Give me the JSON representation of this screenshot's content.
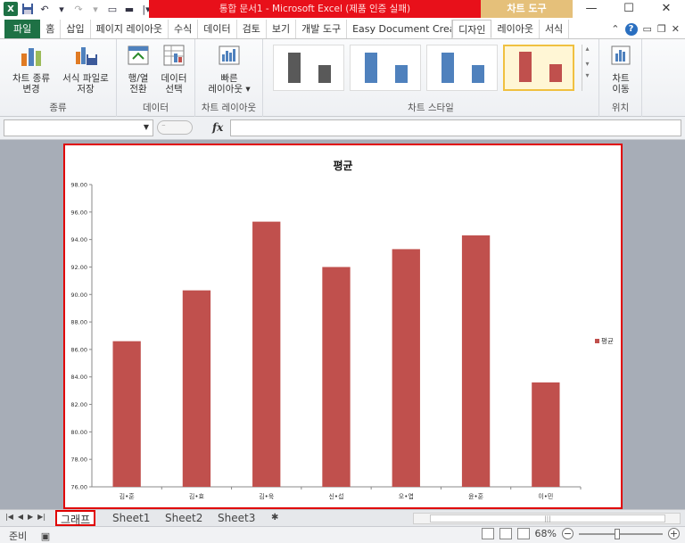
{
  "title_bar": {
    "window_title": "통합 문서1 - Microsoft Excel (제품 인증 실패)",
    "context_tab_group": "차트 도구",
    "minimize": "—",
    "maximize": "☐",
    "close": "✕"
  },
  "ribbon_tabs": {
    "file": "파일",
    "items": [
      "홈",
      "삽입",
      "페이지 레이아웃",
      "수식",
      "데이터",
      "검토",
      "보기",
      "개발 도구",
      "Easy Document Creato",
      "디자인",
      "레이아웃",
      "서식"
    ],
    "active": "디자인"
  },
  "ribbon": {
    "groups": {
      "type": {
        "label": "종류",
        "change_chart_type": "차트 종류\n변경",
        "save_template": "서식 파일로\n저장"
      },
      "data": {
        "label": "데이터",
        "switch_row_col": "행/열\n전환",
        "select_data": "데이터\n선택"
      },
      "layouts": {
        "label": "차트 레이아웃",
        "quick_layout": "빠른\n레이아웃 ▾"
      },
      "styles": {
        "label": "차트 스타일"
      },
      "location": {
        "label": "위치",
        "move_chart": "차트\n이동"
      }
    },
    "style_colors": [
      "#595959",
      "#4f81bd",
      "#4f81bd",
      "#c0504d"
    ]
  },
  "formula_bar": {
    "fx": "fx",
    "namebox_value": "",
    "formula_value": ""
  },
  "chart_data": {
    "type": "bar",
    "title": "평균",
    "categories": [
      "김•훈",
      "김•효",
      "김•욱",
      "신•섭",
      "오•엽",
      "윤•훈",
      "이•민"
    ],
    "series": [
      {
        "name": "평균",
        "color": "#c0504d",
        "values": [
          86.6,
          90.3,
          95.3,
          92.0,
          93.3,
          94.3,
          83.6
        ]
      }
    ],
    "ylim": [
      76,
      98
    ],
    "yticks": [
      "76.00",
      "78.00",
      "80.00",
      "82.00",
      "84.00",
      "86.00",
      "88.00",
      "90.00",
      "92.00",
      "94.00",
      "96.00",
      "98.00"
    ],
    "legend_position": "right",
    "grid": false
  },
  "sheet_tabs": {
    "items": [
      "그래프",
      "Sheet1",
      "Sheet2",
      "Sheet3"
    ],
    "active": "그래프"
  },
  "status_bar": {
    "ready": "준비",
    "zoom": "68%",
    "zoom_level_fraction": 0.68
  }
}
